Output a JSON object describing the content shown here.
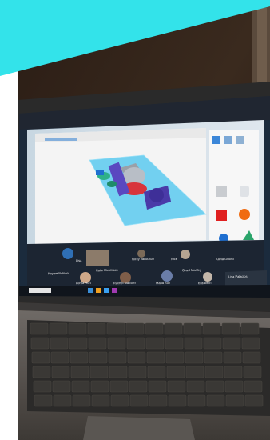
{
  "photo": {
    "subject": "laptop showing a 3D design web app and a video call",
    "accent_band_color": "#33e3ea",
    "wall_color": "#2a1c14",
    "screen_bg": "#1a2a3c",
    "app_bg": "#f2f2f2",
    "workplane_color": "#72d0f0"
  },
  "video_call_names": [
    "Lisa",
    "Nicky Jacobson",
    "Nick",
    "Kayla Gratrix",
    "Lorna Hurt",
    "Rachel Mattson",
    "Maria Sun",
    "Elizabeth",
    "Kaylee Nelson",
    "Lisa Palacios",
    "Grant Manley",
    "Katie Dickinson"
  ],
  "icons": [
    "laptop-icon",
    "keyboard-icon",
    "trackpad-icon",
    "avatar-icon"
  ]
}
